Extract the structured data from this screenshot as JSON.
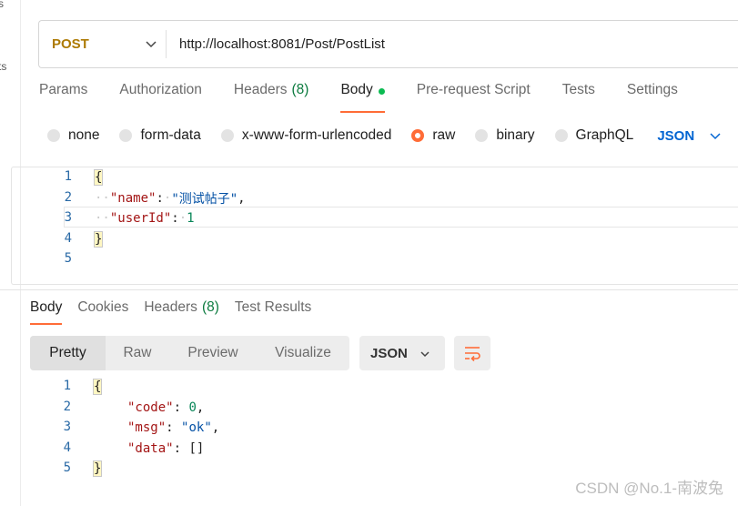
{
  "sidebar": {
    "fragments": [
      "s",
      "ts"
    ]
  },
  "request": {
    "method": "POST",
    "url": "http://localhost:8081/Post/PostList"
  },
  "tabs": {
    "params": "Params",
    "authorization": "Authorization",
    "headers": "Headers",
    "headers_count": "(8)",
    "body": "Body",
    "prerequest": "Pre-request Script",
    "tests": "Tests",
    "settings": "Settings"
  },
  "body_types": {
    "none": "none",
    "form_data": "form-data",
    "urlencoded": "x-www-form-urlencoded",
    "raw": "raw",
    "binary": "binary",
    "graphql": "GraphQL",
    "selected": "raw",
    "format": "JSON"
  },
  "request_body": {
    "line_numbers": [
      "1",
      "2",
      "3",
      "4",
      "5"
    ],
    "open": "{",
    "close": "}",
    "k1": "\"name\"",
    "v1": "\"测试帖子\"",
    "k2": "\"userId\"",
    "v2": "1",
    "colon": ":",
    "comma": ","
  },
  "response": {
    "tabs": {
      "body": "Body",
      "cookies": "Cookies",
      "headers": "Headers",
      "headers_count": "(8)",
      "test_results": "Test Results"
    },
    "views": [
      "Pretty",
      "Raw",
      "Preview",
      "Visualize"
    ],
    "format": "JSON",
    "line_numbers": [
      "1",
      "2",
      "3",
      "4",
      "5"
    ],
    "open": "{",
    "close": "}",
    "k1": "\"code\"",
    "v1": "0",
    "k2": "\"msg\"",
    "v2": "\"ok\"",
    "k3": "\"data\"",
    "v3": "[]",
    "colon": ":",
    "comma": ","
  },
  "watermark": "CSDN @No.1-南波兔",
  "colors": {
    "accent": "#ff6c37",
    "post": "#ad7a03",
    "link": "#0265d2",
    "count": "#0c7b3f"
  }
}
